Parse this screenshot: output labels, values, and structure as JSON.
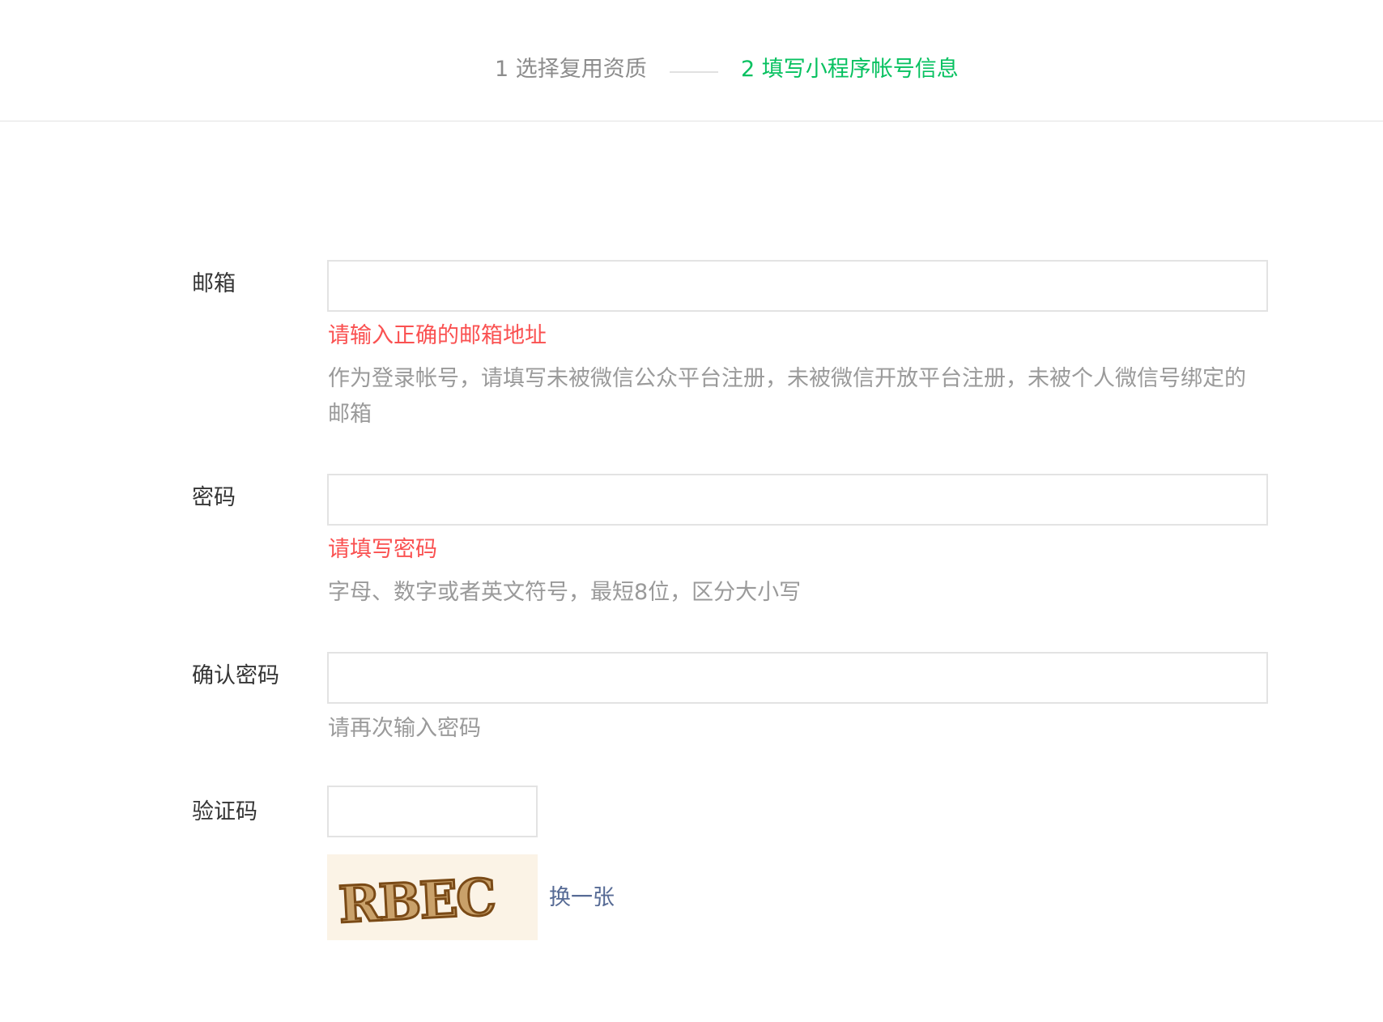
{
  "steps": {
    "step1": "1 选择复用资质",
    "step2": "2 填写小程序帐号信息"
  },
  "form": {
    "email": {
      "label": "邮箱",
      "value": "",
      "error": "请输入正确的邮箱地址",
      "tip": "作为登录帐号，请填写未被微信公众平台注册，未被微信开放平台注册，未被个人微信号绑定的邮箱"
    },
    "password": {
      "label": "密码",
      "value": "",
      "error": "请填写密码",
      "tip": "字母、数字或者英文符号，最短8位，区分大小写"
    },
    "confirm_password": {
      "label": "确认密码",
      "value": "",
      "tip": "请再次输入密码"
    },
    "captcha": {
      "label": "验证码",
      "value": "",
      "image_text": "RBEC",
      "refresh_label": "换一张"
    }
  },
  "colors": {
    "active_step": "#07c160",
    "error": "#fa5151",
    "link": "#576b95",
    "tip": "#9a9a9a"
  }
}
